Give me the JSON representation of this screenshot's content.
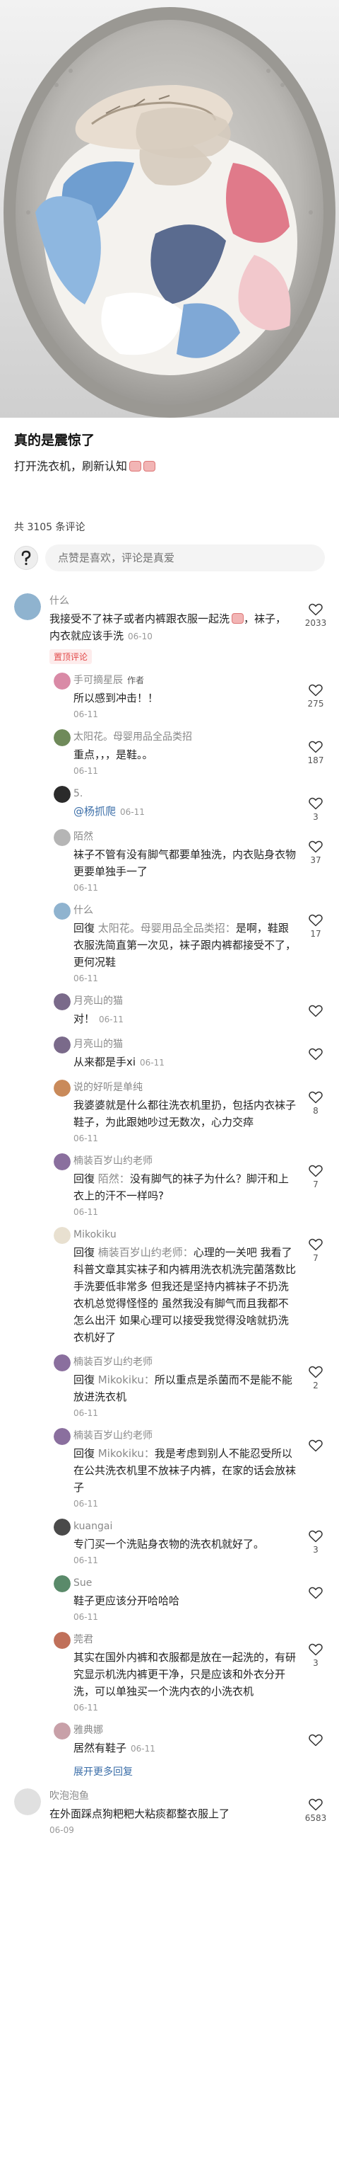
{
  "post": {
    "title": "真的是震惊了",
    "body": "打开洗衣机，刷新认知"
  },
  "comments_header": {
    "count_text": "共 3105 条评论"
  },
  "comment_input": {
    "placeholder": "点赞是喜欢，评论是真爱"
  },
  "colors": {
    "link": "#3b6ea8",
    "pinned": "#e24a4a",
    "muted": "#999999"
  },
  "comments": [
    {
      "kind": "top",
      "name": "什么",
      "text": "我接受不了袜子或者内裤跟衣服一起洗",
      "text2": "，袜子，内衣就应该手洗",
      "time_inline": "06-10",
      "badge": "置顶评论",
      "likes": "2033",
      "avatar_color": "#8fb3cf"
    },
    {
      "kind": "reply",
      "name": "手可摘星辰",
      "author_tag": "作者",
      "text": "所以感到冲击！！",
      "time": "06-11",
      "likes": "275",
      "avatar_color": "#d98aa6"
    },
    {
      "kind": "reply",
      "name": "太阳花。母婴用品全品类招",
      "text": "重点，，，是鞋。。",
      "time": "06-11",
      "likes": "187",
      "avatar_color": "#6f8a5a"
    },
    {
      "kind": "reply",
      "name": "5.",
      "mention": "@杨抓爬",
      "time_inline": "06-11",
      "likes": "3",
      "avatar_color": "#2b2b2b"
    },
    {
      "kind": "reply",
      "name": "陌然",
      "text": "袜子不管有没有脚气都要单独洗，内衣贴身衣物更要单独手一了",
      "time": "06-11",
      "likes": "37",
      "avatar_color": "#b5b5b5"
    },
    {
      "kind": "reply",
      "name": "什么",
      "reply_label": "回復",
      "reply_target": "太阳花。母婴用品全品类招：",
      "text": "是啊，鞋跟衣服洗简直第一次见，袜子跟内裤都接受不了，更何况鞋",
      "time": "06-11",
      "likes": "17",
      "avatar_color": "#8fb3cf"
    },
    {
      "kind": "reply",
      "name": "月亮山的猫",
      "text": "对！",
      "time_inline": "06-11",
      "likes": "",
      "avatar_color": "#7a6a8a"
    },
    {
      "kind": "reply",
      "name": "月亮山的猫",
      "text": "从来都是手xi",
      "time_inline": "06-11",
      "likes": "",
      "avatar_color": "#7a6a8a"
    },
    {
      "kind": "reply",
      "name": "说的好听是单纯",
      "text": "我婆婆就是什么都往洗衣机里扔，包括内衣袜子鞋子，为此跟她吵过无数次，心力交瘁",
      "time": "06-11",
      "likes": "8",
      "avatar_color": "#c98a5a"
    },
    {
      "kind": "reply",
      "name": "楠装百岁山约老师",
      "reply_label": "回復",
      "reply_target": "陌然：",
      "text": "没有脚气的袜子为什么？脚汗和上衣上的汗不一样吗?",
      "time": "06-11",
      "likes": "7",
      "avatar_color": "#8a6f9e"
    },
    {
      "kind": "reply",
      "name": "Mikokiku",
      "reply_label": "回復",
      "reply_target": "楠装百岁山约老师：",
      "text": "心理的一关吧 我看了科普文章其实袜子和内裤用洗衣机洗完菌落数比手洗要低非常多 但我还是坚持内裤袜子不扔洗衣机总觉得怪怪的 虽然我没有脚气而且我都不怎么出汗 如果心理可以接受我觉得没啥就扔洗衣机好了",
      "time": "",
      "likes": "7",
      "avatar_color": "#e8e0d0"
    },
    {
      "kind": "reply",
      "name": "楠装百岁山约老师",
      "reply_label": "回復",
      "reply_target": "Mikokiku：",
      "text": "所以重点是杀菌而不是能不能放进洗衣机",
      "time": "06-11",
      "likes": "2",
      "avatar_color": "#8a6f9e"
    },
    {
      "kind": "reply",
      "name": "楠装百岁山约老师",
      "reply_label": "回復",
      "reply_target": "Mikokiku：",
      "text": "我是考虑到别人不能忍受所以在公共洗衣机里不放袜子内裤，在家的话会放袜子",
      "time": "06-11",
      "likes": "",
      "avatar_color": "#8a6f9e"
    },
    {
      "kind": "reply",
      "name": "kuangai",
      "text": "专门买一个洗贴身衣物的洗衣机就好了。",
      "time": "06-11",
      "likes": "3",
      "avatar_color": "#4a4a4a"
    },
    {
      "kind": "reply",
      "name": "Sue",
      "text": "鞋子更应该分开哈哈哈",
      "time": "06-11",
      "likes": "",
      "avatar_color": "#5a8a6a"
    },
    {
      "kind": "reply",
      "name": "莞君",
      "text": "其实在国外内裤和衣服都是放在一起洗的，有研究显示机洗内裤更干净，只是应该和外衣分开洗，可以单独买一个洗内衣的小洗衣机",
      "time": "06-11",
      "likes": "3",
      "avatar_color": "#c0705a"
    },
    {
      "kind": "reply",
      "name": "雅典娜",
      "text": "居然有鞋子",
      "time_inline": "06-11",
      "likes": "",
      "avatar_color": "#c8a0a8"
    },
    {
      "kind": "expand",
      "text": "展开更多回复"
    },
    {
      "kind": "top",
      "name": "吹泡泡鱼",
      "text": "在外面踩点狗粑粑大粘痰都整衣服上了",
      "time": "06-09",
      "likes": "6583",
      "avatar_color": "#e0e0e0"
    }
  ]
}
